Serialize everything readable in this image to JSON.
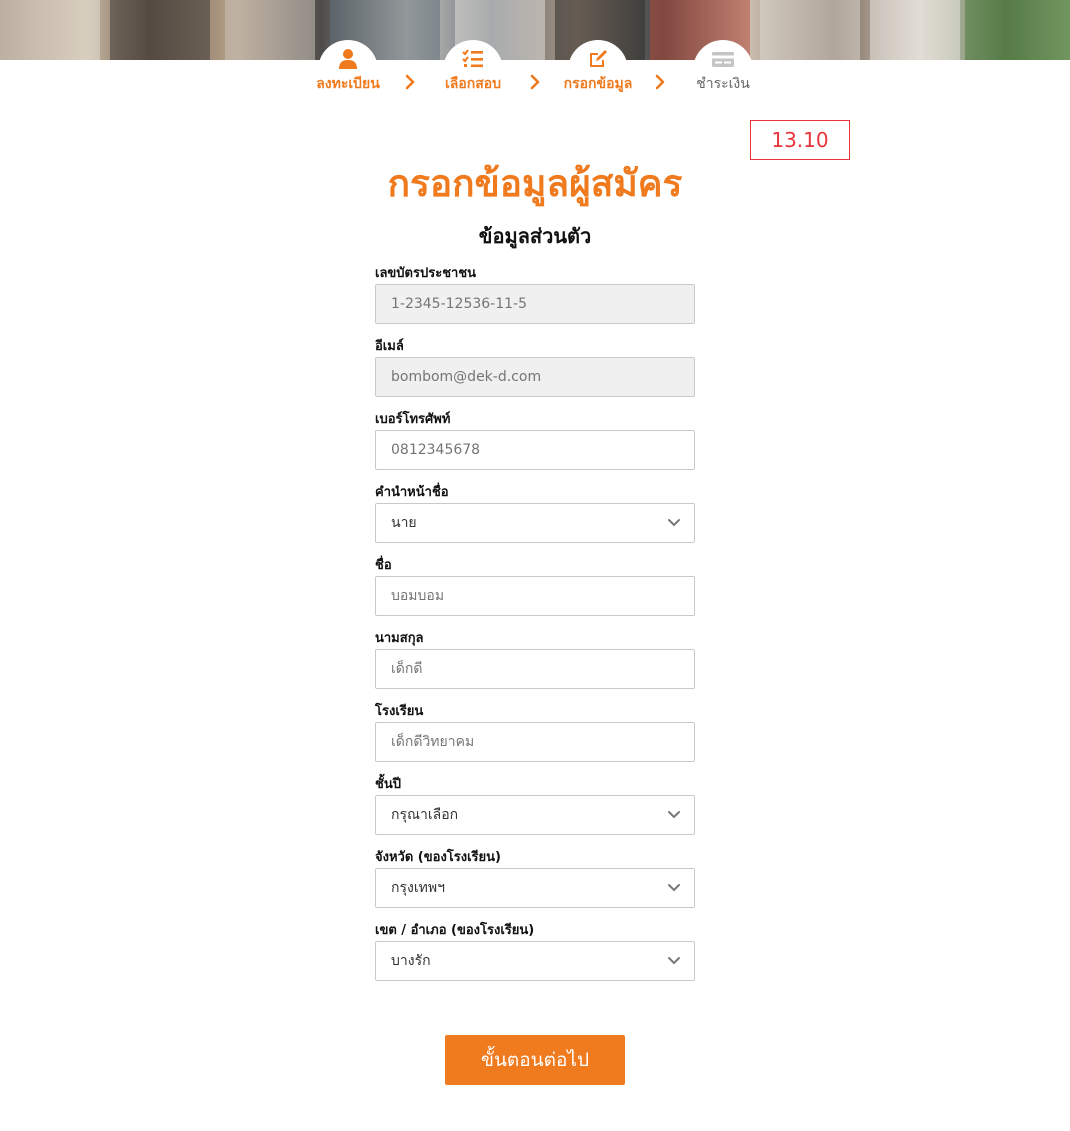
{
  "steps": [
    {
      "label": "ลงทะเบียน",
      "icon": "user-icon",
      "state": "done"
    },
    {
      "label": "เลือกสอบ",
      "icon": "checklist-icon",
      "state": "done"
    },
    {
      "label": "กรอกข้อมูล",
      "icon": "edit-icon",
      "state": "current"
    },
    {
      "label": "ชำระเงิน",
      "icon": "credit-card-icon",
      "state": "pending"
    }
  ],
  "timer": "13.10",
  "page_title": "กรอกข้อมูลผู้สมัคร",
  "section_title": "ข้อมูลส่วนตัว",
  "fields": {
    "id_card": {
      "label": "เลขบัตรประชาชน",
      "placeholder": "1-2345-12536-11-5"
    },
    "email": {
      "label": "อีเมล์",
      "placeholder": "bombom@dek-d.com"
    },
    "phone": {
      "label": "เบอร์โทรศัพท์",
      "placeholder": "0812345678"
    },
    "title_prefix": {
      "label": "คำนำหน้าชื่อ",
      "value": "นาย"
    },
    "first_name": {
      "label": "ชื่อ",
      "placeholder": "บอมบอม"
    },
    "last_name": {
      "label": "นามสกุล",
      "placeholder": "เด็กดี"
    },
    "school": {
      "label": "โรงเรียน",
      "placeholder": "เด็กดีวิทยาคม"
    },
    "grade": {
      "label": "ชั้นปี",
      "value": "กรุณาเลือก"
    },
    "province": {
      "label": "จังหวัด (ของโรงเรียน)",
      "value": "กรุงเทพฯ"
    },
    "district": {
      "label": "เขต / อำเภอ (ของโรงเรียน)",
      "value": "บางรัก"
    }
  },
  "next_button": "ขั้นตอนต่อไป",
  "colors": {
    "accent": "#f07a1e",
    "timer": "#e8333a",
    "pending": "#999999"
  }
}
